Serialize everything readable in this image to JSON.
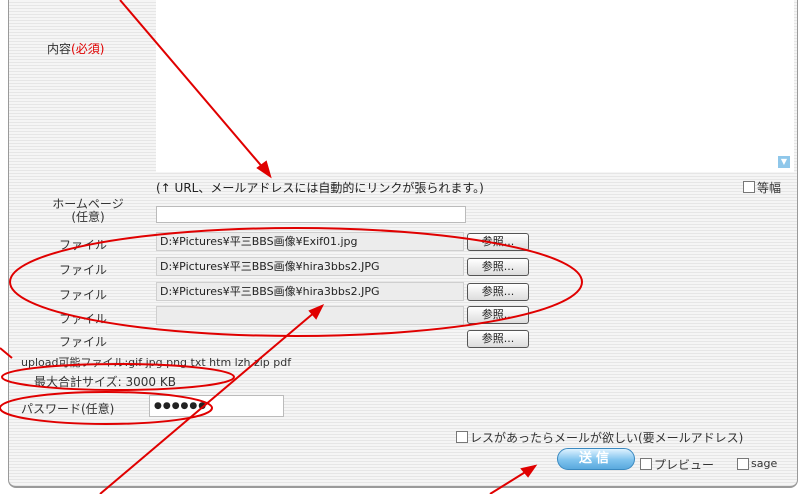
{
  "form": {
    "content_label": "内容",
    "content_required": "(必須)",
    "url_note": "(↑ URL、メールアドレスには自動的にリンクが張られます。)",
    "monospace_label": "等幅",
    "homepage_label_1": "ホームページ",
    "homepage_label_2": "(任意)",
    "homepage_value": "",
    "file_label": "ファイル",
    "files": [
      "D:¥Pictures¥平三BBS画像¥Exif01.jpg",
      "D:¥Pictures¥平三BBS画像¥hira3bbs2.JPG",
      "D:¥Pictures¥平三BBS画像¥hira3bbs2.JPG",
      "",
      ""
    ],
    "browse_label": "参照...",
    "upload_types": "upload可能ファイル:gif jpg png txt htm lzh zip pdf",
    "max_size": "最大合計サイズ: 3000 KB",
    "password_label": "パスワード(任意)",
    "password_value": "●●●●●●",
    "mail_notify_label": "レスがあったらメールが欲しい(要メールアドレス)",
    "submit_label": "送信",
    "preview_label": "プレビュー",
    "sage_label": "sage"
  },
  "colors": {
    "required": "#e00000",
    "annotation": "#e00000",
    "submit": "#5aa9dd"
  }
}
